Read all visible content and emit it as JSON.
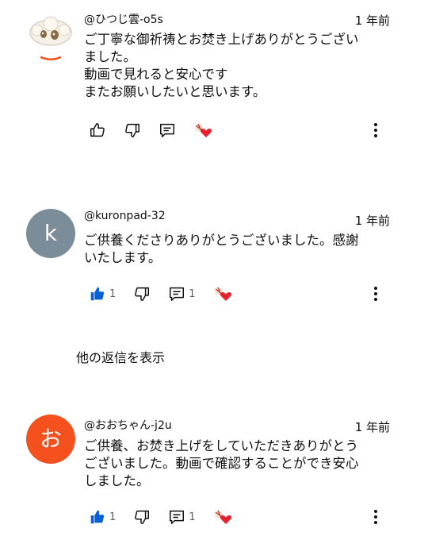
{
  "comments": [
    {
      "author": "@ひつじ雲-o5s",
      "time": "1 年前",
      "text": "ご丁寧な御祈祷とお焚き上げありがとうござい\nました。\n動画で見れると安心です\nまたお願いしたいと思います。",
      "like_count": "",
      "reply_count": "",
      "liked": false,
      "avatar_letter": "",
      "avatar_icon": "sheep-cloud-avatar-icon"
    },
    {
      "author": "@kuronpad-32",
      "time": "1 年前",
      "text": "ご供養くださりありがとうございました。感謝\nいたします。",
      "like_count": "1",
      "reply_count": "1",
      "liked": true,
      "avatar_letter": "k",
      "avatar_color": "#7b8d99"
    },
    {
      "author": "@おおちゃん-j2u",
      "time": "1 年前",
      "text": "ご供養、お焚き上げをしていただきありがとう\nございました。動画で確認することができ安心\nしました。",
      "like_count": "1",
      "reply_count": "1",
      "liked": true,
      "avatar_letter": "お",
      "avatar_color": "#f4511e"
    }
  ],
  "show_replies_label": "他の返信を表示",
  "colors": {
    "liked_blue": "#065fd4",
    "heart_red": "#e5212e"
  }
}
